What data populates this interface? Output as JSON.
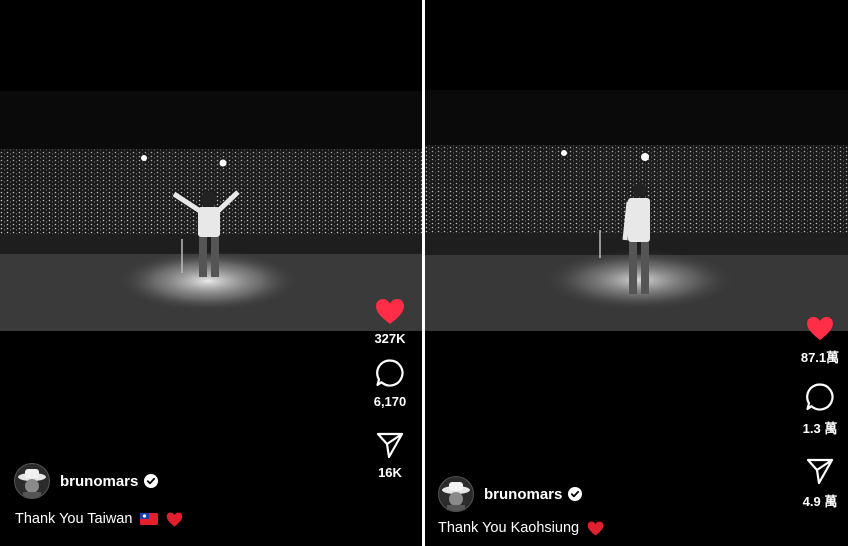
{
  "left": {
    "username": "bruno​mars",
    "caption": "Thank You Taiwan",
    "likes": "327K",
    "comments": "6,170",
    "shares": "16K",
    "caption_emojis": [
      "taiwan-flag",
      "red-heart"
    ]
  },
  "right": {
    "username": "bruno​mars",
    "caption": "Thank You Kaohsiung",
    "likes": "87.1萬",
    "comments": "1.3 萬",
    "shares": "4.9 萬",
    "caption_emojis": [
      "red-heart"
    ]
  },
  "colors": {
    "like": "#ff2d45",
    "background": "#000000",
    "text": "#ffffff",
    "divider": "#ffffff"
  }
}
